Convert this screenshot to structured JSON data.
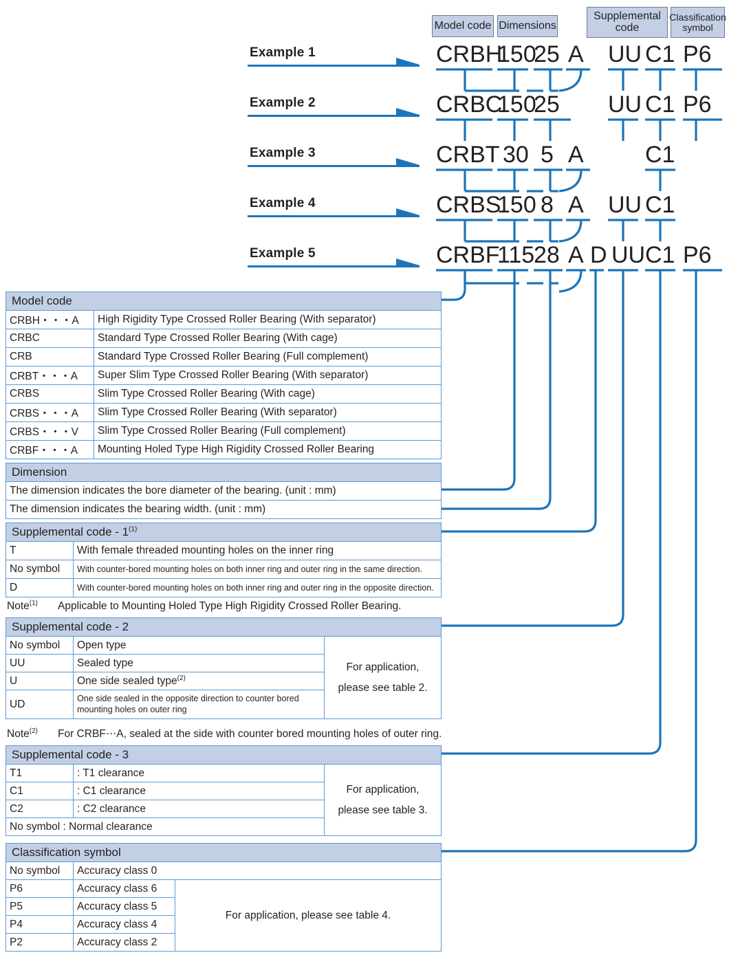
{
  "headers": [
    {
      "id": "model-code",
      "label": "Model code"
    },
    {
      "id": "dimensions",
      "label": "Dimensions"
    },
    {
      "id": "supplemental-code",
      "label": "Supplemental\ncode"
    },
    {
      "id": "classification-symbol",
      "label": "Classification\nsymbol"
    }
  ],
  "examples": [
    {
      "label": "Example 1",
      "model": "CRBH",
      "dim1": "150",
      "dim2": "25",
      "sup1": "A",
      "supD": "",
      "sup2": "UU",
      "sup3": "C1",
      "cls": "P6"
    },
    {
      "label": "Example 2",
      "model": "CRBC",
      "dim1": "150",
      "dim2": "25",
      "sup1": "",
      "supD": "",
      "sup2": "UU",
      "sup3": "C1",
      "cls": "P6"
    },
    {
      "label": "Example 3",
      "model": "CRBT",
      "dim1": "30",
      "dim2": "5",
      "sup1": "A",
      "supD": "",
      "sup2": "",
      "sup3": "C1",
      "cls": ""
    },
    {
      "label": "Example 4",
      "model": "CRBS",
      "dim1": "150",
      "dim2": "8",
      "sup1": "A",
      "supD": "",
      "sup2": "UU",
      "sup3": "C1",
      "cls": ""
    },
    {
      "label": "Example 5",
      "model": "CRBF",
      "dim1": "115",
      "dim2": "28",
      "sup1": "A",
      "supD": "D",
      "sup2": "UU",
      "sup3": "C1",
      "cls": "P6"
    }
  ],
  "model_code_table": {
    "title": "Model code",
    "rows": [
      {
        "code": "CRBH・・・A",
        "desc": "High Rigidity Type Crossed Roller Bearing (With separator)"
      },
      {
        "code": "CRBC",
        "desc": "Standard Type Crossed Roller Bearing (With cage)"
      },
      {
        "code": "CRB",
        "desc": "Standard Type Crossed Roller Bearing (Full complement)"
      },
      {
        "code": "CRBT・・・A",
        "desc": "Super Slim Type Crossed Roller Bearing (With separator)"
      },
      {
        "code": "CRBS",
        "desc": "Slim Type Crossed Roller Bearing (With cage)"
      },
      {
        "code": "CRBS・・・A",
        "desc": "Slim Type Crossed Roller Bearing (With separator)"
      },
      {
        "code": "CRBS・・・V",
        "desc": "Slim Type Crossed Roller Bearing (Full complement)"
      },
      {
        "code": "CRBF・・・A",
        "desc": "Mounting Holed Type High Rigidity Crossed Roller Bearing"
      }
    ]
  },
  "dimension_table": {
    "title": "Dimension",
    "rows": [
      "The dimension indicates the bore diameter of the bearing. (unit : mm)",
      "The dimension indicates the bearing width. (unit : mm)"
    ]
  },
  "supplemental_1_table": {
    "title": "Supplemental code - 1",
    "title_sup": "(1)",
    "rows": [
      {
        "code": "T",
        "desc": "With female threaded mounting holes on the inner ring",
        "small": false
      },
      {
        "code": "No symbol",
        "desc": "With counter-bored mounting holes on both inner ring and outer ring in the same direction.",
        "small": true
      },
      {
        "code": "D",
        "desc": "With counter-bored mounting holes on both inner ring and outer ring in the opposite direction.",
        "small": true
      }
    ],
    "note_label": "Note",
    "note_sup": "(1)",
    "note_text": "Applicable to Mounting Holed Type High Rigidity Crossed Roller Bearing."
  },
  "supplemental_2_table": {
    "title": "Supplemental code - 2",
    "rows": [
      {
        "code": "No symbol",
        "desc": "Open type",
        "sup": "",
        "small": false
      },
      {
        "code": "UU",
        "desc": "Sealed type",
        "sup": "",
        "small": false
      },
      {
        "code": "U",
        "desc": "One side sealed type",
        "sup": "(2)",
        "small": false
      },
      {
        "code": "UD",
        "desc": "One side sealed in the opposite direction to counter bored mounting holes on outer ring",
        "sup": "",
        "small": true
      }
    ],
    "side_note_line1": "For application,",
    "side_note_line2": "please see table 2.",
    "note_label": "Note",
    "note_sup": "(2)",
    "note_text": "For CRBF⋯A, sealed at the side with counter bored mounting holes of outer ring."
  },
  "supplemental_3_table": {
    "title": "Supplemental code - 3",
    "rows": [
      {
        "code": "T1",
        "desc": ": T1 clearance"
      },
      {
        "code": "C1",
        "desc": ": C1 clearance"
      },
      {
        "code": "C2",
        "desc": ": C2 clearance"
      },
      {
        "code": "No symbol",
        "desc": ": Normal clearance",
        "merged": true
      }
    ],
    "side_note_line1": "For application,",
    "side_note_line2": "please see table 3."
  },
  "classification_table": {
    "title": "Classification symbol",
    "rows": [
      {
        "code": "No symbol",
        "desc": "Accuracy class 0"
      },
      {
        "code": "P6",
        "desc": "Accuracy class 6"
      },
      {
        "code": "P5",
        "desc": "Accuracy class 5"
      },
      {
        "code": "P4",
        "desc": "Accuracy class 4"
      },
      {
        "code": "P2",
        "desc": "Accuracy class 2"
      }
    ],
    "side_note": "For application, please see table 4."
  },
  "colors": {
    "line_blue": "#1b75bb",
    "header_fill": "#c3cfe4",
    "table_border": "#5a9ad4",
    "text": "#231f20"
  }
}
